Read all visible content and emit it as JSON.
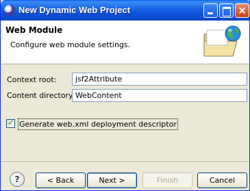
{
  "window": {
    "title": "New Dynamic Web Project",
    "buttons": {
      "minimize": "minimize",
      "maximize": "maximize",
      "close": "×"
    }
  },
  "banner": {
    "title": "Web Module",
    "description": "Configure web module settings.",
    "graphic_icon": "folder-globe-icon"
  },
  "form": {
    "context_root": {
      "label": "Context root:",
      "value": "jsf2Attribute"
    },
    "content_directory": {
      "label": "Content directory:",
      "value": "WebContent"
    },
    "generate_descriptor": {
      "label": "Generate web.xml deployment descriptor",
      "checked": true
    }
  },
  "footer": {
    "help": "?",
    "back": "< Back",
    "next": "Next >",
    "finish": "Finish",
    "cancel": "Cancel"
  },
  "colors": {
    "titlebar": "#0b4fd6",
    "window_bg": "#ece9d8",
    "banner_bg": "#ffffff",
    "close_button": "#c8441c"
  }
}
